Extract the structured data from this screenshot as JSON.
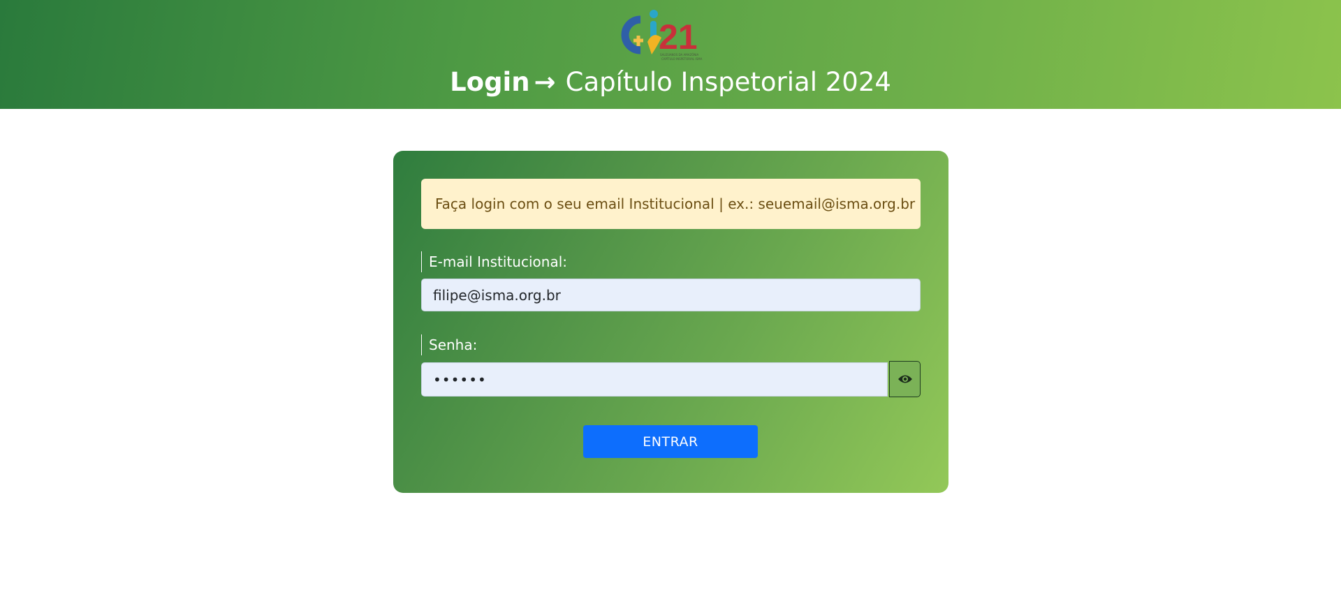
{
  "header": {
    "login_word": "Login",
    "arrow": "→",
    "title": "Capítulo Inspetorial 2024",
    "logo": {
      "number": "21",
      "caption_line1": "SALESIANOS DA AMAZÔNIA",
      "caption_line2": "CAPÍTULO INSPETORIAL ISMA"
    }
  },
  "login_card": {
    "alert_text": "Faça login com o seu email Institucional | ex.: seuemail@isma.org.br",
    "email": {
      "label": "E-mail Institucional:",
      "value": "filipe@isma.org.br"
    },
    "password": {
      "label": "Senha:",
      "masked_value": "••••••",
      "toggle_icon": "eye-icon"
    },
    "submit_label": "ENTRAR"
  },
  "colors": {
    "header_gradient_start": "#2a7a3c",
    "header_gradient_end": "#8cc34c",
    "card_gradient_start": "#2f7d3e",
    "card_gradient_end": "#93c858",
    "alert_background": "#fff2cc",
    "alert_text": "#6b4e12",
    "input_background": "#e8effb",
    "button_primary": "#0d6efd"
  }
}
